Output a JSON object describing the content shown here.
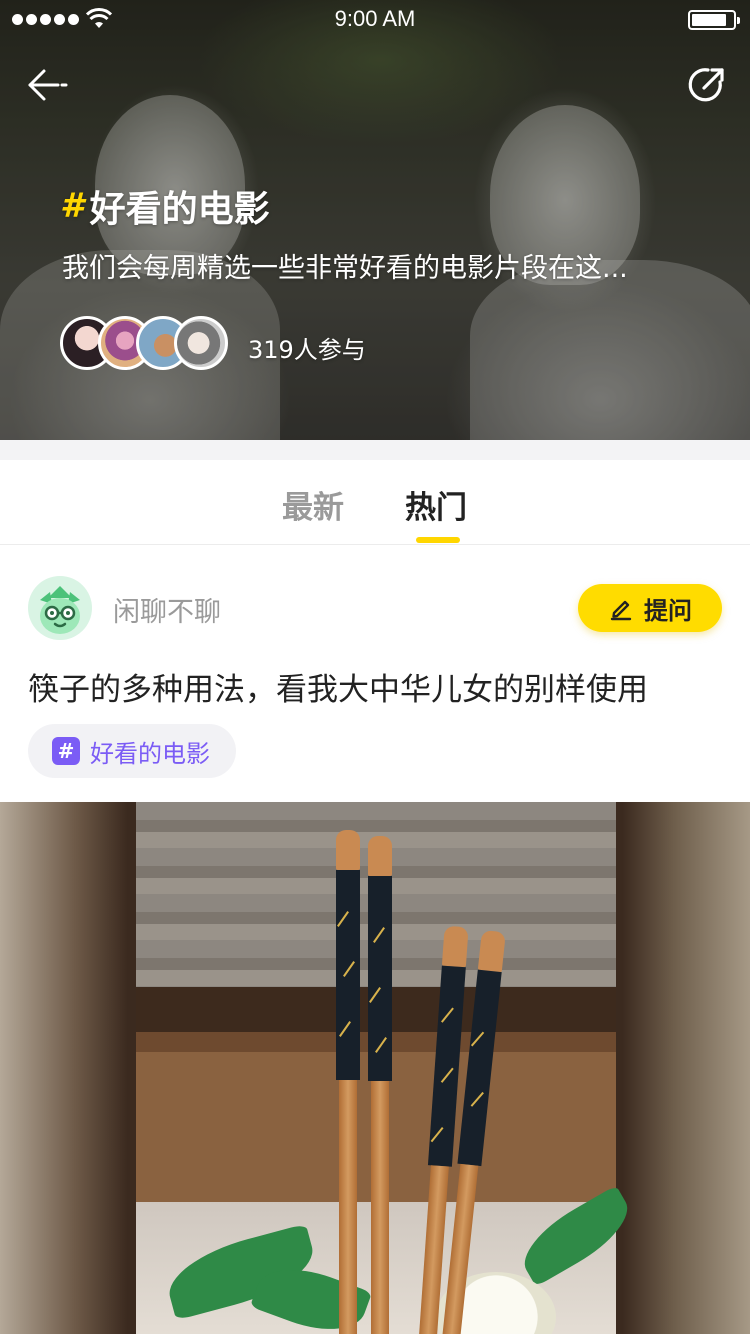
{
  "status_bar": {
    "time": "9:00 AM"
  },
  "header": {
    "back_icon": "arrow-left-icon",
    "share_icon": "share-icon",
    "topic_hash": "#",
    "topic_title": "好看的电影",
    "topic_description": "我们会每周精选一些非常好看的电影片段在这...",
    "participants_text": "319人参与"
  },
  "tabs": [
    {
      "label": "最新",
      "active": false
    },
    {
      "label": "热门",
      "active": true
    }
  ],
  "post": {
    "user_name": "闲聊不聊",
    "ask_button_label": "提问",
    "ask_icon": "pencil-icon",
    "title": "筷子的多种用法，看我大中华儿女的别样使用",
    "topic_chip_icon": "#",
    "topic_chip_label": "好看的电影"
  },
  "colors": {
    "accent_yellow": "#ffdc00",
    "topic_purple": "#7b5cf5",
    "text_primary": "#222222",
    "text_secondary": "#9a9a9a"
  }
}
